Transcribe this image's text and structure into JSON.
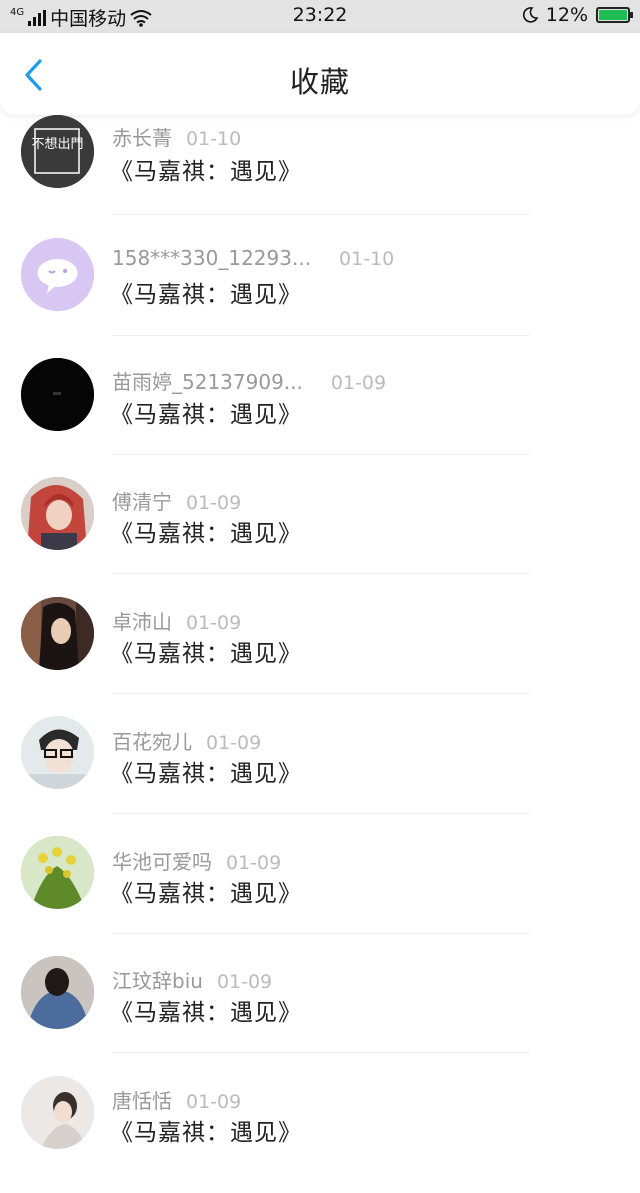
{
  "status_bar": {
    "network": "4G",
    "carrier": "中国移动",
    "time": "23:22",
    "battery": "12%"
  },
  "header": {
    "title": "收藏"
  },
  "items": [
    {
      "user": "赤长菁",
      "date": "01-10",
      "title": "《马嘉祺：遇见》",
      "avatar_icon": "text-avatar-icon",
      "avatar_text": "不想出門"
    },
    {
      "user": "158***330_12293...",
      "date": "01-10",
      "title": "《马嘉祺：遇见》",
      "avatar_icon": "chat-bubble-avatar-icon"
    },
    {
      "user": "苗雨婷_52137909...",
      "date": "01-09",
      "title": "《马嘉祺：遇见》",
      "avatar_icon": "dark-avatar-icon"
    },
    {
      "user": "傅清宁",
      "date": "01-09",
      "title": "《马嘉祺：遇见》",
      "avatar_icon": "anime-girl-avatar-icon"
    },
    {
      "user": "卓沛山",
      "date": "01-09",
      "title": "《马嘉祺：遇见》",
      "avatar_icon": "photo-avatar-icon"
    },
    {
      "user": "百花宛儿",
      "date": "01-09",
      "title": "《马嘉祺：遇见》",
      "avatar_icon": "glasses-boy-avatar-icon"
    },
    {
      "user": "华池可爱吗",
      "date": "01-09",
      "title": "《马嘉祺：遇见》",
      "avatar_icon": "flowers-avatar-icon"
    },
    {
      "user": "江玟辞biu",
      "date": "01-09",
      "title": "《马嘉祺：遇见》",
      "avatar_icon": "hoodie-avatar-icon"
    },
    {
      "user": "唐恬恬",
      "date": "01-09",
      "title": "《马嘉祺：遇见》",
      "avatar_icon": "light-photo-avatar-icon"
    }
  ]
}
